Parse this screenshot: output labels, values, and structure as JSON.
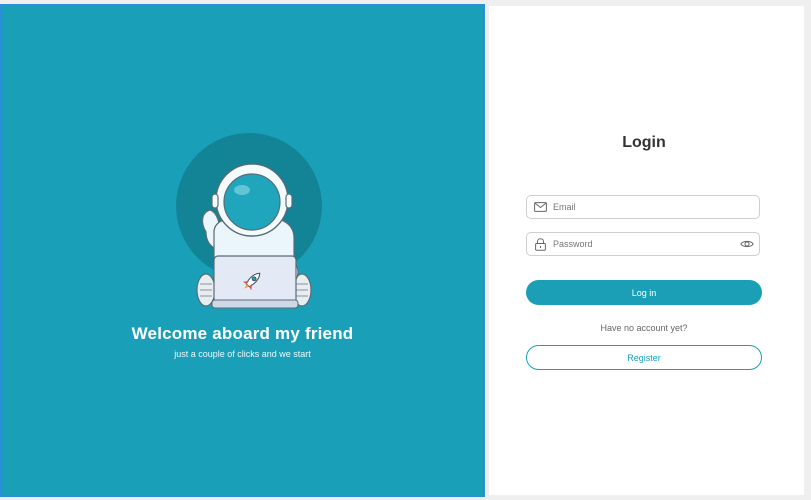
{
  "welcome": {
    "title": "Welcome aboard my friend",
    "subtitle": "just a couple of clicks and we start"
  },
  "login": {
    "title": "Login",
    "email_placeholder": "Email",
    "password_placeholder": "Password",
    "login_button": "Log in",
    "no_account_text": "Have no account yet?",
    "register_button": "Register"
  },
  "colors": {
    "accent": "#1a9fb7",
    "panel_background": "#19a0b8",
    "selection_border": "#2a8de0"
  },
  "icons": [
    "astronaut-illustration",
    "rocket-icon",
    "mail-icon",
    "lock-icon",
    "eye-icon"
  ]
}
